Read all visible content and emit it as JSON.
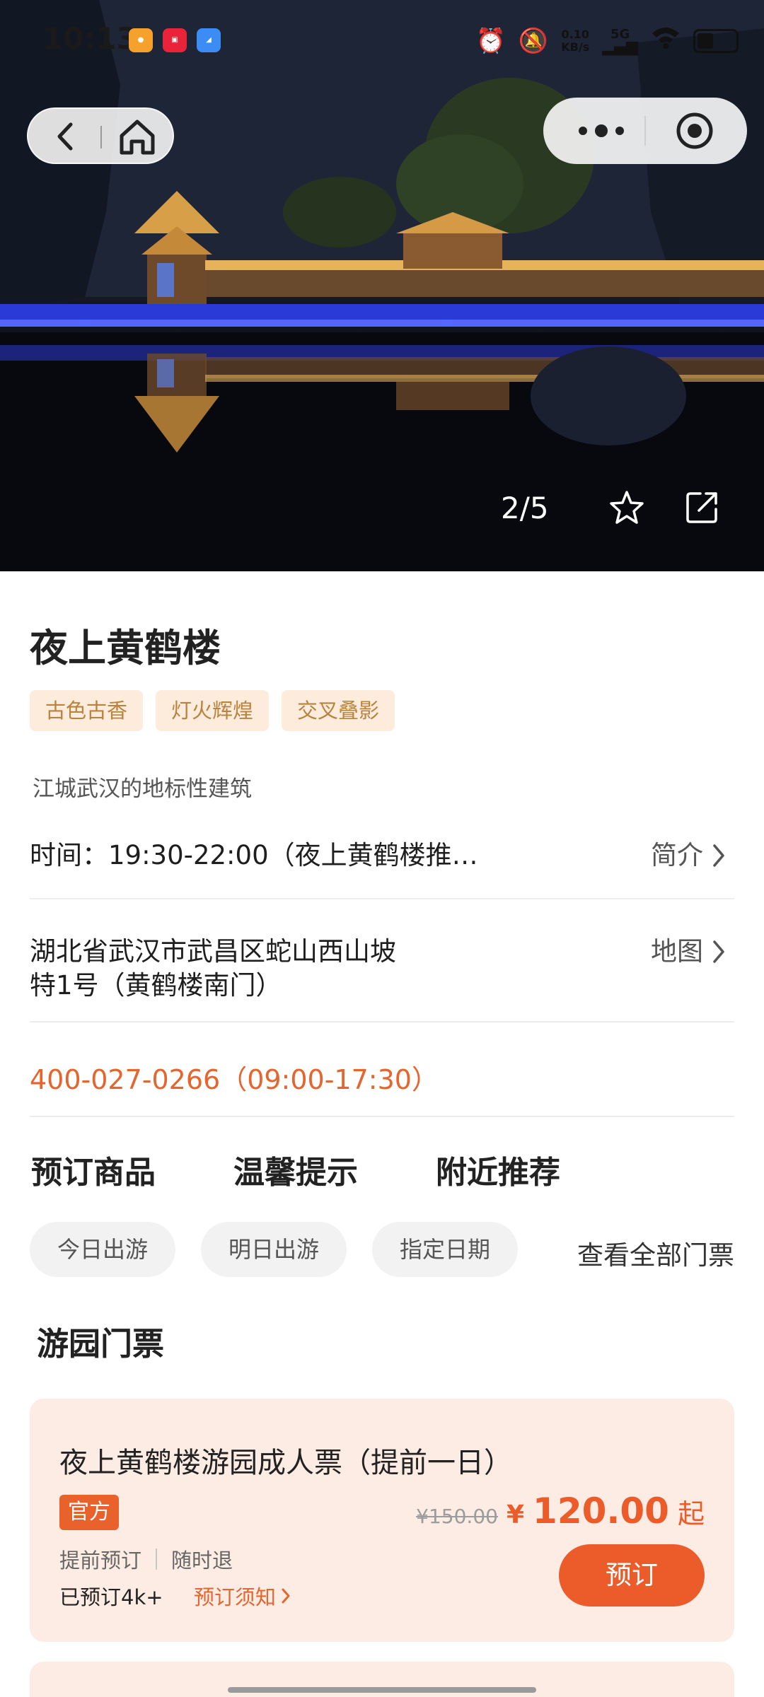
{
  "status_bar": {
    "time": "10:13",
    "net_speed_value": "0.10",
    "net_speed_unit": "KB/s",
    "signal_label": "5G"
  },
  "hero": {
    "image_counter": "2/5"
  },
  "attraction": {
    "title": "夜上黄鹤楼",
    "tags": [
      "古色古香",
      "灯火辉煌",
      "交叉叠影"
    ],
    "subtitle": "江城武汉的地标性建筑",
    "time_text": "时间：19:30-22:00（夜上黄鹤楼推…",
    "intro_link": "简介",
    "address_line1": "湖北省武汉市武昌区蛇山西山坡",
    "address_line2": "特1号（黄鹤楼南门）",
    "map_link": "地图",
    "phone": "400-027-0266（09:00-17:30）"
  },
  "section_tabs": [
    "预订商品",
    "温馨提示",
    "附近推荐"
  ],
  "date_chips": [
    "今日出游",
    "明日出游",
    "指定日期"
  ],
  "all_tickets_link": "查看全部门票",
  "ticket_section_title": "游园门票",
  "ticket": {
    "name": "夜上黄鹤楼游园成人票（提前一日）",
    "badge": "官方",
    "original_price": "¥150.00",
    "currency": "¥",
    "price": "120.00",
    "price_suffix": "起",
    "features": [
      "提前预订",
      "随时退"
    ],
    "booked_count": "已预订4k+",
    "notice_link": "预订须知",
    "book_button": "预订"
  },
  "colors": {
    "accent": "#ec5c2a",
    "tag_bg": "#fdecdc",
    "tag_text": "#b9833f",
    "card_bg": "#fdece4"
  }
}
